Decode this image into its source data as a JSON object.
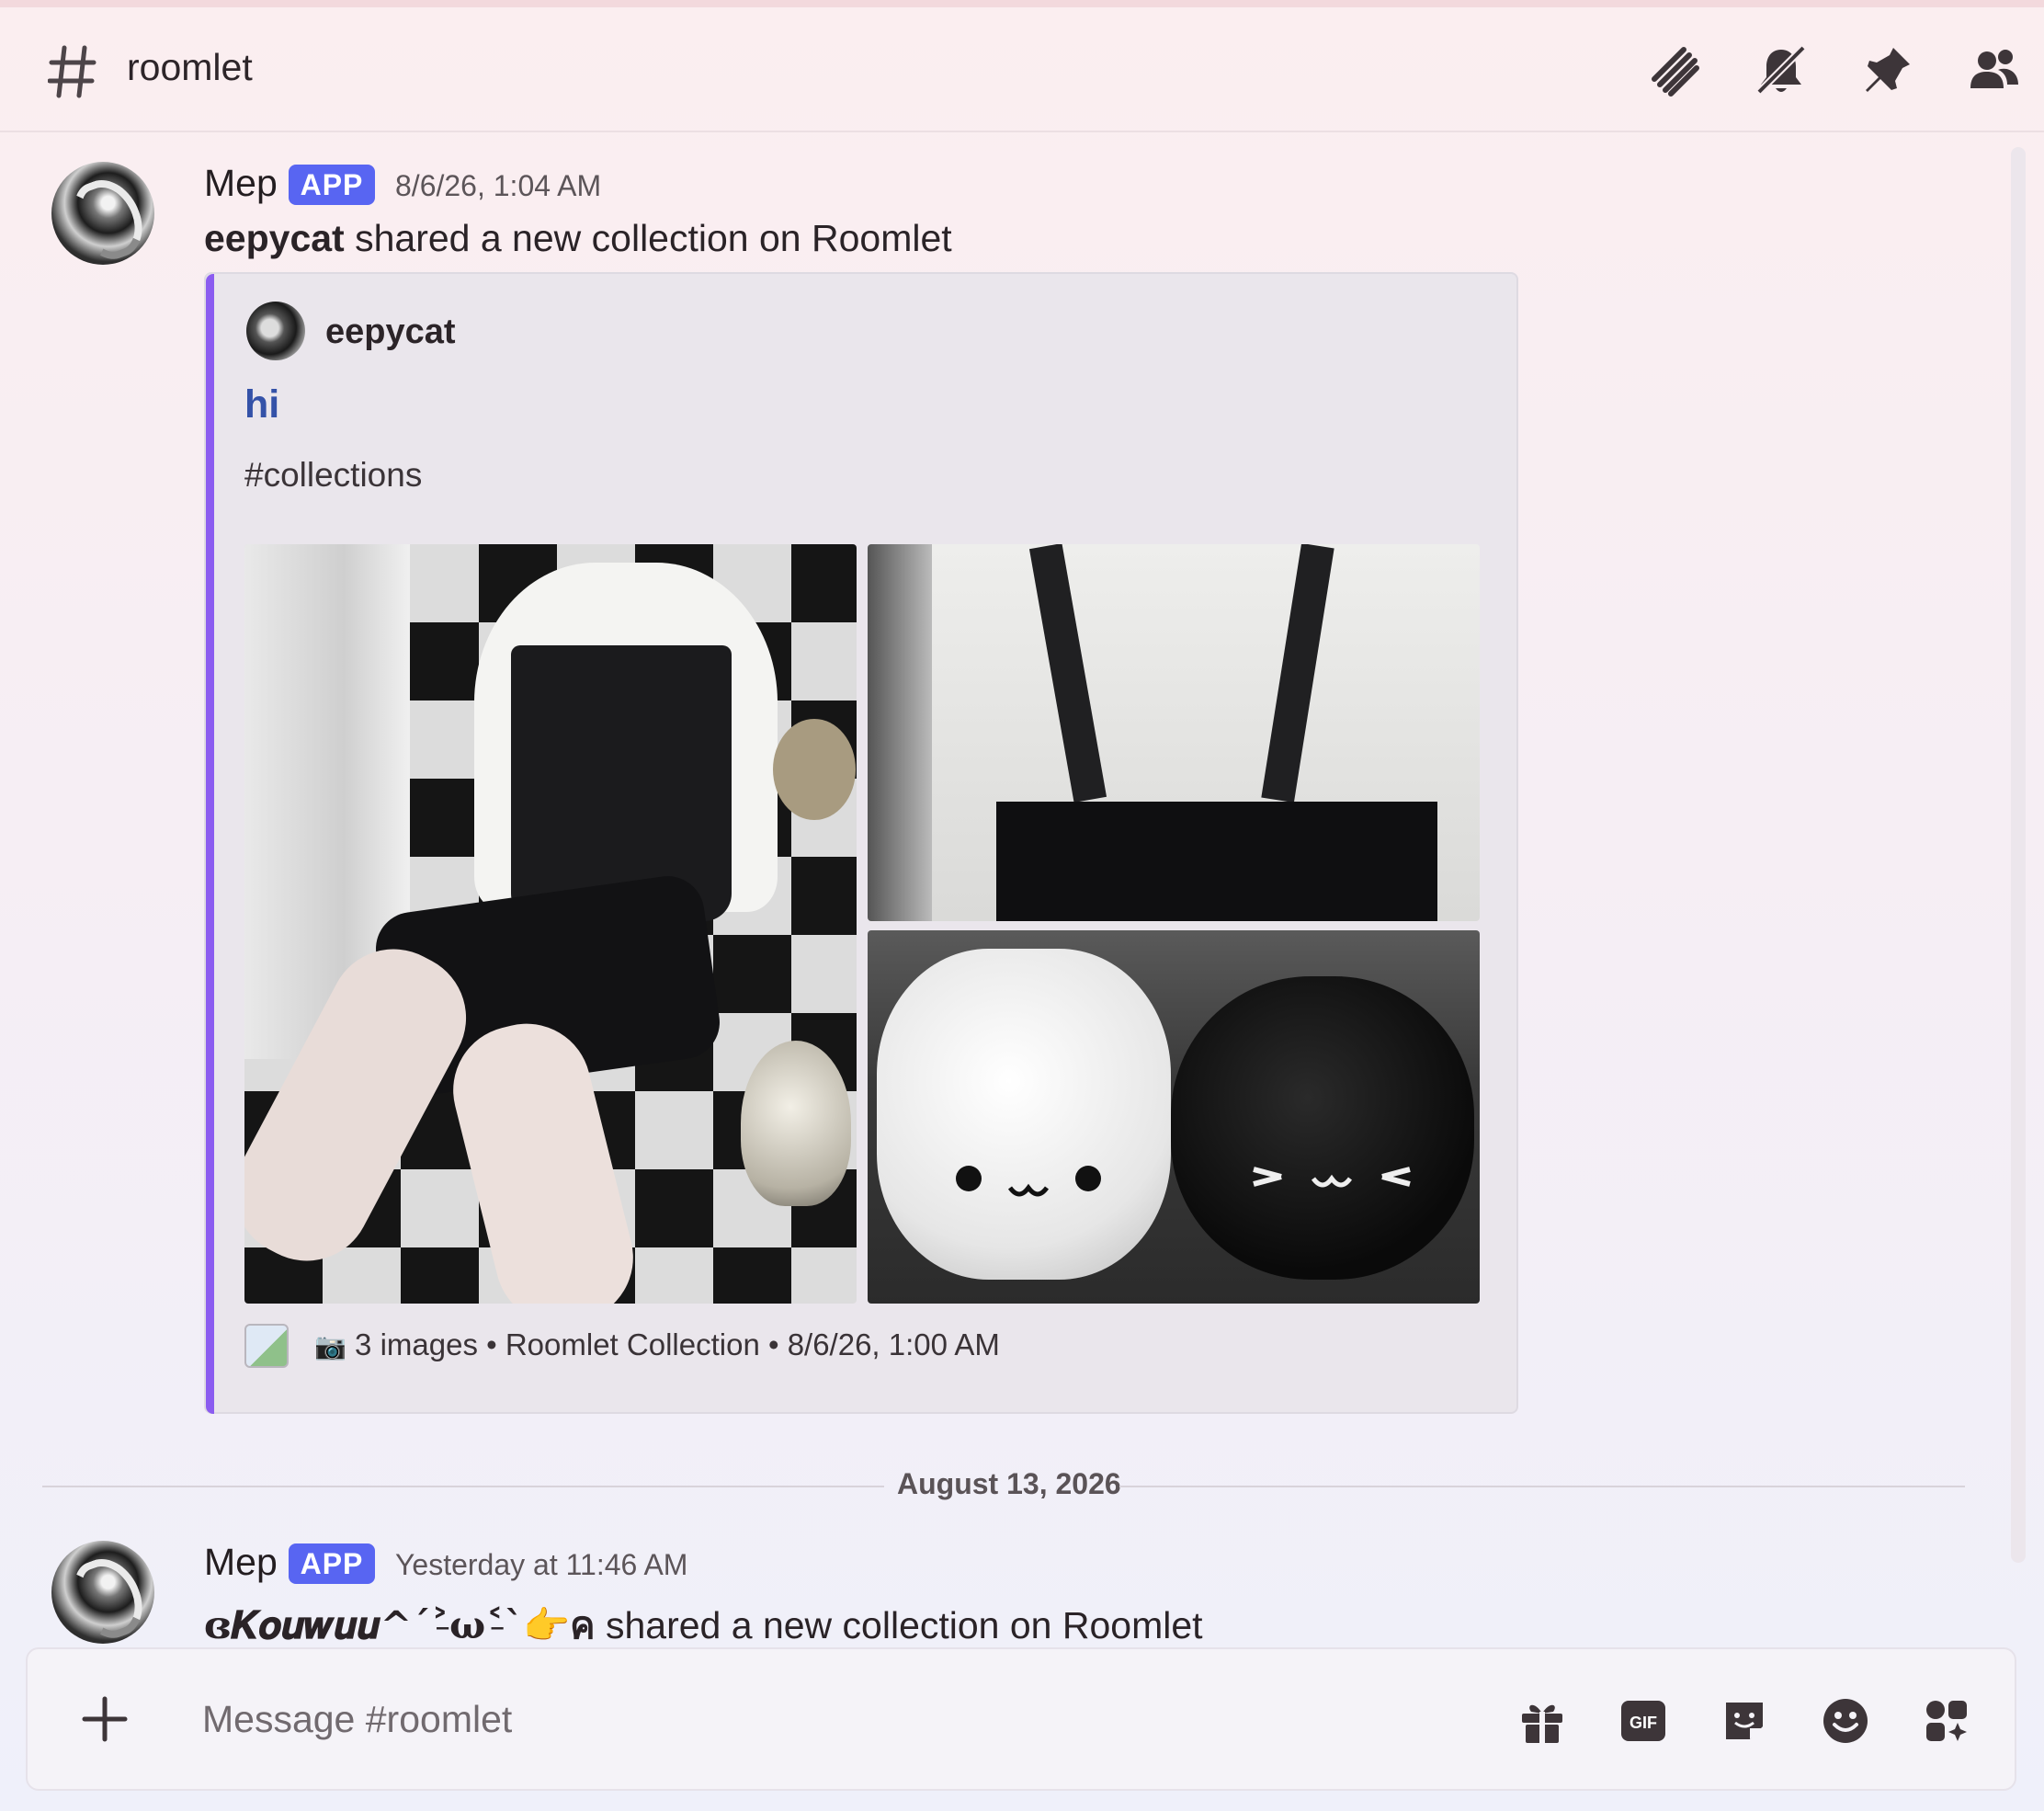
{
  "channel": {
    "name": "roomlet"
  },
  "header_icons": [
    "threads-icon",
    "mute-icon",
    "pin-icon",
    "members-icon"
  ],
  "messages": [
    {
      "author": "Mep",
      "badge": "APP",
      "timestamp": "8/6/26, 1:04 AM",
      "user": "eepycat",
      "text": " shared a new collection on Roomlet",
      "embed": {
        "author": "eepycat",
        "title": "hi",
        "description": "#collections",
        "images": [
          "outfit-photo",
          "shirt-suspenders-photo",
          "cat-plushies-photo"
        ],
        "footer": "3 images • Roomlet Collection",
        "footer_sep": " • ",
        "footer_time": "8/6/26, 1:00 AM"
      }
    },
    {
      "author": "Mep",
      "badge": "APP",
      "timestamp": "Yesterday at 11:46 AM",
      "user": "ɞ𝑲𝒐𝒖𝒘𝒖𝒖^ˊ˃̵ω˂̵ˋ👉ค",
      "text": " shared a new collection on Roomlet"
    }
  ],
  "divider": {
    "date": "August 13, 2026"
  },
  "composer": {
    "placeholder": "Message #roomlet",
    "icons": [
      "gift-icon",
      "gif-icon",
      "sticker-icon",
      "emoji-icon",
      "apps-icon"
    ],
    "gif_label": "GIF"
  },
  "colors": {
    "accent": "#5865f2",
    "embed_bar": "#8b5cf0",
    "link": "#3452a8"
  }
}
